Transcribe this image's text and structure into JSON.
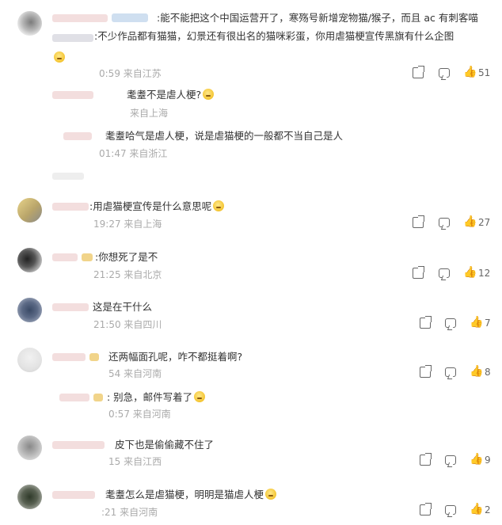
{
  "comments": [
    {
      "line1": ":能不能把这个中国运营开了，寒殇号新增宠物猫/猴子，而且 ac 有刺客喵",
      "line2": ":不少作品都有猫猫，幻景还有很出名的猫咪彩蛋，你用虐猫梗宣传黑旗有什么企图",
      "meta": "0:59 来自江苏",
      "likes": "51"
    },
    {
      "text": "耄耋不是虐人梗?",
      "meta": "来自上海"
    },
    {
      "text": "耄耋哈气是虐人梗，说是虐猫梗的一般都不当自己是人",
      "meta": "01:47 来自浙江"
    },
    {
      "text": ":用虐猫梗宣传是什么意思呢",
      "meta": "19:27 来自上海",
      "likes": "27"
    },
    {
      "text": ":你想死了是不",
      "meta": "21:25 来自北京",
      "likes": "12"
    },
    {
      "text": "这是在干什么",
      "meta": "21:50 来自四川",
      "likes": "7"
    },
    {
      "text": "还两幅面孔呢，咋不都挺着啊?",
      "meta": "54 来自河南",
      "likes": "8"
    },
    {
      "text": ": 别急，邮件写着了",
      "meta": "0:57 来自河南"
    },
    {
      "text": "皮下也是偷偷藏不住了",
      "meta": "15 来自江西",
      "likes": "9"
    },
    {
      "text": "耄耋怎么是虐猫梗，明明是猫虐人梗",
      "meta": ":21 来自河南",
      "likes": "2"
    }
  ],
  "icons": {
    "share": "share-icon",
    "reply": "comment-icon",
    "like": "thumbs-up-icon"
  }
}
